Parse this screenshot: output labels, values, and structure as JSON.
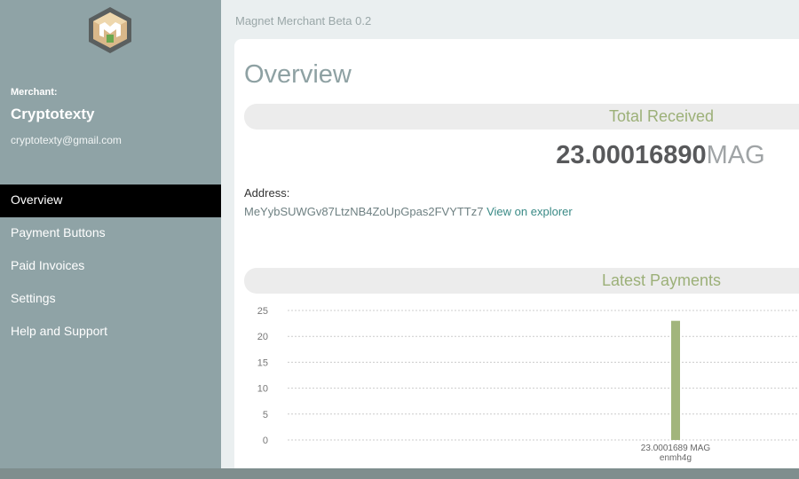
{
  "app": {
    "title": "Magnet Merchant Beta 0.2"
  },
  "merchant": {
    "label": "Merchant:",
    "name": "Cryptotexty",
    "email": "cryptotexty@gmail.com"
  },
  "nav": {
    "items": [
      {
        "label": "Overview",
        "active": true
      },
      {
        "label": "Payment Buttons",
        "active": false
      },
      {
        "label": "Paid Invoices",
        "active": false
      },
      {
        "label": "Settings",
        "active": false
      },
      {
        "label": "Help and Support",
        "active": false
      }
    ]
  },
  "overview": {
    "title": "Overview",
    "total_section": "Total Received",
    "total_amount": "23.00016890",
    "total_unit": "MAG",
    "address_label": "Address:",
    "address": "MeYybSUWGv87LtzNB4ZoUpGpas2FVYTTz7",
    "explorer_link": "View on explorer",
    "latest_section": "Latest Payments"
  },
  "colors": {
    "sidebar": "#8fa3a6",
    "active_nav": "#000000",
    "accent_green": "#9cb078",
    "bar": "#a2b57c"
  },
  "chart_data": {
    "type": "bar",
    "categories": [
      "23.0001689 MAG\nenmh4g"
    ],
    "values": [
      23.0001689
    ],
    "ylim": [
      0,
      25
    ],
    "yticks": [
      0,
      5,
      10,
      15,
      20,
      25
    ],
    "grid": true,
    "data_labels": [
      {
        "line1": "23.0001689 MAG",
        "line2": "enmh4g"
      }
    ]
  }
}
